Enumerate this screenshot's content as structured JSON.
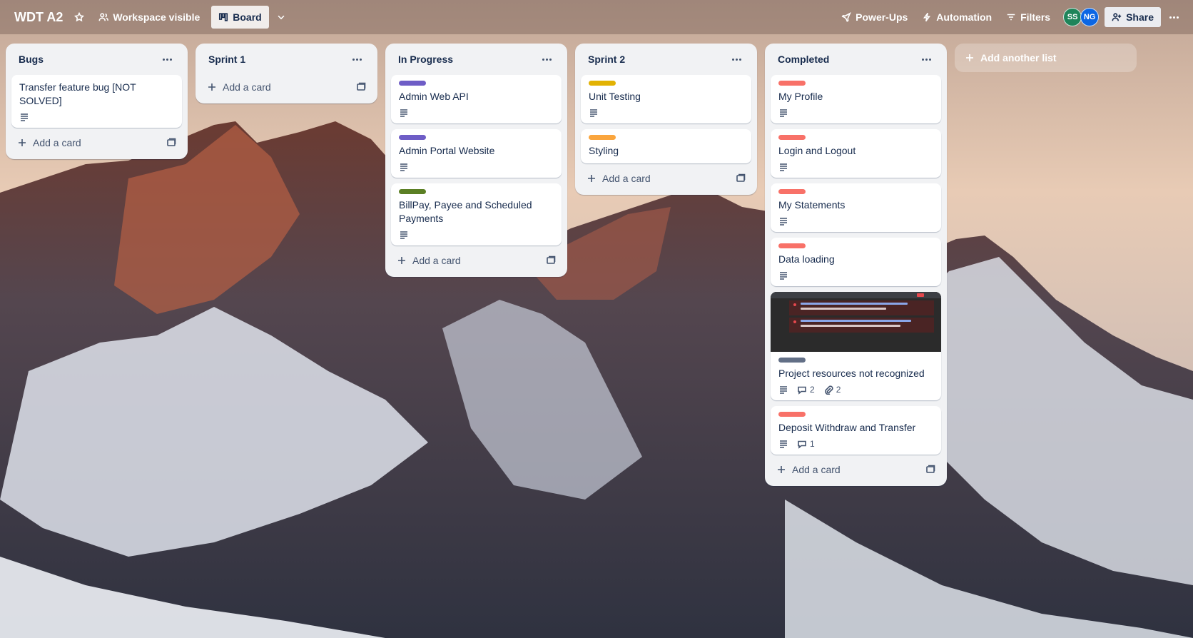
{
  "header": {
    "board_title": "WDT A2",
    "visibility_label": "Workspace visible",
    "view_label": "Board",
    "power_ups_label": "Power-Ups",
    "automation_label": "Automation",
    "filters_label": "Filters",
    "share_label": "Share",
    "avatars": [
      {
        "initials": "SS",
        "color": "#1f845a"
      },
      {
        "initials": "NG",
        "color": "#0c66e4"
      }
    ]
  },
  "lists": [
    {
      "title": "Bugs",
      "add_card_label": "Add a card",
      "cards": [
        {
          "title": "Transfer feature bug [NOT SOLVED]",
          "label_color": null,
          "has_description": true
        }
      ]
    },
    {
      "title": "Sprint 1",
      "add_card_label": "Add a card",
      "cards": []
    },
    {
      "title": "In Progress",
      "add_card_label": "Add a card",
      "cards": [
        {
          "title": "Admin Web API",
          "label_color": "#6e5dc6",
          "has_description": true
        },
        {
          "title": "Admin Portal Website",
          "label_color": "#6e5dc6",
          "has_description": true
        },
        {
          "title": "BillPay, Payee and Scheduled Payments",
          "label_color": "#5b7f24",
          "has_description": true
        }
      ]
    },
    {
      "title": "Sprint 2",
      "add_card_label": "Add a card",
      "cards": [
        {
          "title": "Unit Testing",
          "label_color": "#e2b203",
          "has_description": true
        },
        {
          "title": "Styling",
          "label_color": "#faa53d",
          "has_description": false
        }
      ]
    },
    {
      "title": "Completed",
      "add_card_label": "Add a card",
      "cards": [
        {
          "title": "My Profile",
          "label_color": "#f87168",
          "has_description": true
        },
        {
          "title": "Login and Logout",
          "label_color": "#f87168",
          "has_description": true
        },
        {
          "title": "My Statements",
          "label_color": "#f87168",
          "has_description": true
        },
        {
          "title": "Data loading",
          "label_color": "#f87168",
          "has_description": true
        },
        {
          "title": "Project resources not recognized",
          "label_color": "#626f86",
          "has_description": true,
          "has_cover": true,
          "comments": "2",
          "attachments": "2"
        },
        {
          "title": "Deposit Withdraw and Transfer",
          "label_color": "#f87168",
          "has_description": true,
          "comments": "1"
        }
      ]
    }
  ],
  "add_list_label": "Add another list",
  "icons": {
    "star": "star-icon",
    "visibility": "people-icon",
    "board": "board-icon",
    "chevron": "chevron-down-icon",
    "power_ups": "rocket-icon",
    "automation": "lightning-icon",
    "filters": "filter-icon",
    "share": "person-add-icon",
    "more": "more-icon",
    "description": "description-icon",
    "comment": "comment-icon",
    "attachment": "paperclip-icon",
    "template": "template-icon",
    "plus": "plus-icon"
  }
}
